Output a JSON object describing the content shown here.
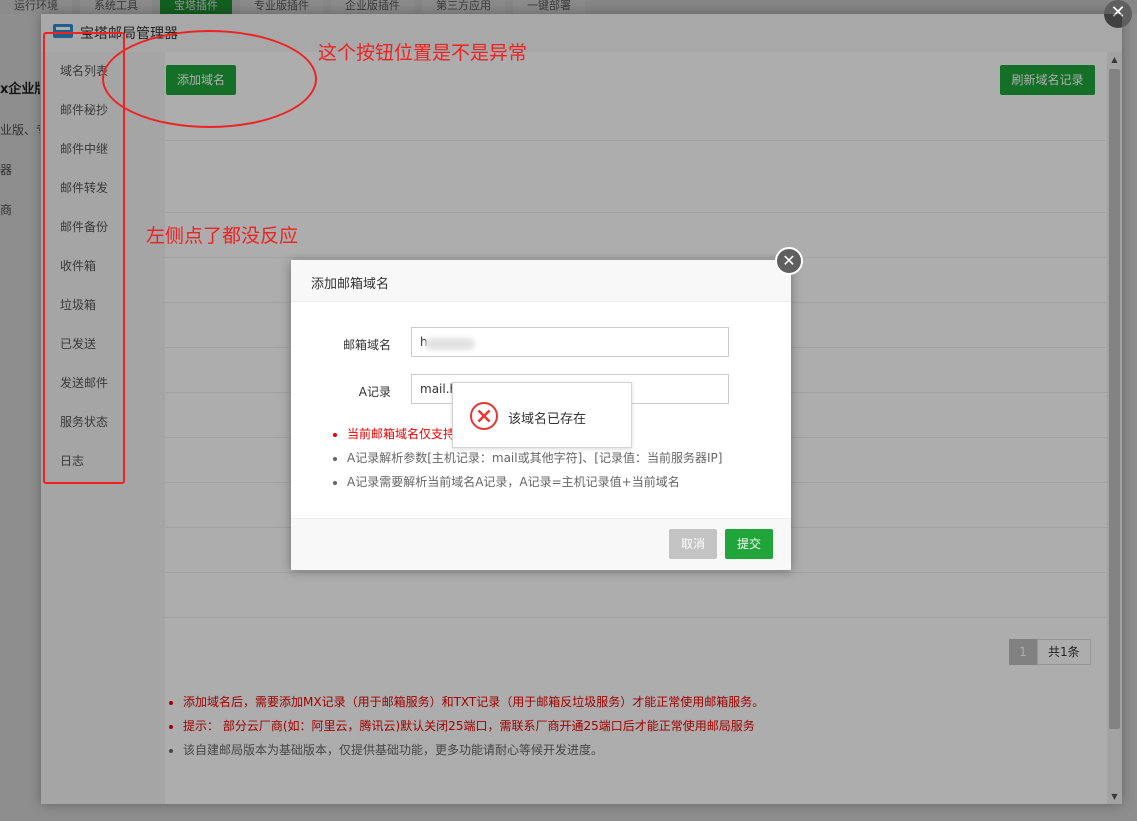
{
  "background": {
    "tabs": [
      "运行环境",
      "系统工具",
      "宝塔插件",
      "专业版插件",
      "企业版插件",
      "第三方应用",
      "一键部署"
    ],
    "active_tab": "宝塔插件",
    "left_fragments": [
      "x企业版",
      "业版、专",
      "器",
      "商"
    ]
  },
  "window": {
    "title": "宝塔邮局管理器",
    "close_symbol": "✕"
  },
  "sidebar": {
    "items": [
      "域名列表",
      "邮件秘抄",
      "邮件中继",
      "邮件转发",
      "邮件备份",
      "收件箱",
      "垃圾箱",
      "已发送",
      "发送邮件",
      "服务状态",
      "日志"
    ]
  },
  "toolbar": {
    "add_domain": "添加域名",
    "refresh_domain": "刷新域名记录"
  },
  "pagination": {
    "current": "1",
    "total": "共1条"
  },
  "tips": [
    {
      "text": "添加域名后，需要添加MX记录（用于邮箱服务）和TXT记录（用于邮箱反垃圾服务）才能正常使用邮箱服务。",
      "color": "red"
    },
    {
      "text": "提示： 部分云厂商(如：阿里云，腾讯云)默认关闭25端口，需联系厂商开通25端口后才能正常使用邮局服务",
      "color": "red"
    },
    {
      "text": "该自建邮局版本为基础版本，仅提供基础功能，更多功能请耐心等候开发进度。",
      "color": "gray"
    }
  ],
  "dialog": {
    "title": "添加邮箱域名",
    "close_symbol": "✕",
    "fields": {
      "domain": {
        "label": "邮箱域名",
        "value": "h"
      },
      "a_record": {
        "label": "A记录",
        "value": "mail.h"
      }
    },
    "notes": [
      {
        "text": "当前邮箱域名仅支持",
        "color": "red"
      },
      {
        "text": "A记录解析参数[主机记录：mail或其他字符]、[记录值：当前服务器IP]",
        "color": "gray"
      },
      {
        "text": "A记录需要解析当前域名A记录，A记录=主机记录值+当前域名",
        "color": "gray"
      }
    ],
    "cancel": "取消",
    "submit": "提交"
  },
  "toast": {
    "icon": "error-circle-icon",
    "message": "该域名已存在"
  },
  "annotations": {
    "button_note": "这个按钮位置是不是异常",
    "sidebar_note": "左侧点了都没反应",
    "color": "#ee2222"
  },
  "colors": {
    "accent": "#20a53a",
    "error": "#ee0000"
  }
}
